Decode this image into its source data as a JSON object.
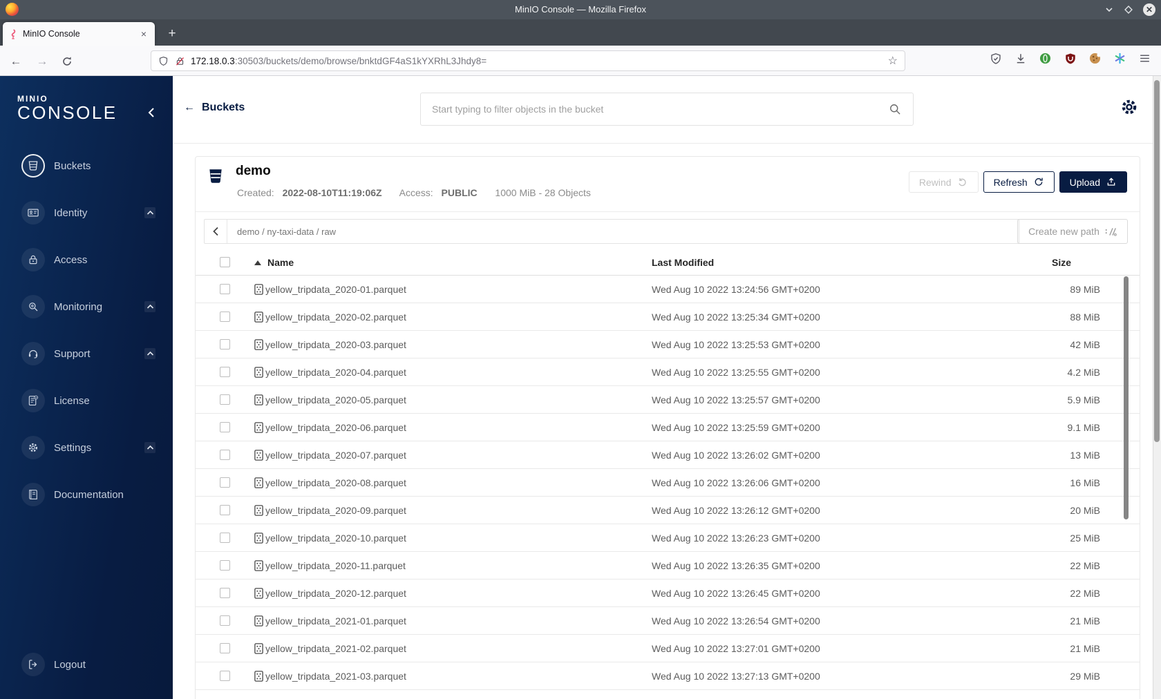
{
  "browser": {
    "window_title": "MinIO Console — Mozilla Firefox",
    "tab": {
      "title": "MinIO Console",
      "close_glyph": "×"
    },
    "new_tab_glyph": "+",
    "nav": {
      "back_glyph": "←",
      "forward_glyph": "→"
    },
    "url": {
      "host": "172.18.0.3",
      "rest": ":30503/buckets/demo/browse/bnktdGF4aS1kYXRhL3Jhdy8="
    },
    "star_glyph": "☆",
    "extension_icons": [
      "shield-check-icon",
      "download-icon",
      "green-extension-icon",
      "ublock-origin-icon",
      "cookie-icon",
      "container-asterisk-icon",
      "menu-icon"
    ]
  },
  "sidebar": {
    "logo_line1": "MINIO",
    "logo_line2": "CONSOLE",
    "items": [
      {
        "label": "Buckets",
        "icon": "bucket-icon",
        "active": true,
        "expandable": false
      },
      {
        "label": "Identity",
        "icon": "identity-icon",
        "active": false,
        "expandable": true
      },
      {
        "label": "Access",
        "icon": "lock-icon",
        "active": false,
        "expandable": false
      },
      {
        "label": "Monitoring",
        "icon": "monitoring-icon",
        "active": false,
        "expandable": true
      },
      {
        "label": "Support",
        "icon": "support-icon",
        "active": false,
        "expandable": true
      },
      {
        "label": "License",
        "icon": "license-icon",
        "active": false,
        "expandable": false
      },
      {
        "label": "Settings",
        "icon": "settings-icon",
        "active": false,
        "expandable": true
      },
      {
        "label": "Documentation",
        "icon": "documentation-icon",
        "active": false,
        "expandable": false
      }
    ],
    "logout": {
      "label": "Logout",
      "icon": "logout-icon"
    }
  },
  "header": {
    "back_glyph": "←",
    "back_label": "Buckets",
    "search_placeholder": "Start typing to filter objects in the bucket"
  },
  "bucket": {
    "name": "demo",
    "created_label": "Created:",
    "created_value": "2022-08-10T11:19:06Z",
    "access_label": "Access:",
    "access_value": "PUBLIC",
    "usage": "1000 MiB - 28 Objects",
    "actions": {
      "rewind": "Rewind",
      "refresh": "Refresh",
      "upload": "Upload"
    }
  },
  "browse": {
    "path": "demo / ny-taxi-data / raw",
    "create_path_label": "Create new path"
  },
  "table": {
    "columns": {
      "name": "Name",
      "modified": "Last Modified",
      "size": "Size"
    },
    "sort": "ascending",
    "rows": [
      {
        "name": "yellow_tripdata_2020-01.parquet",
        "modified": "Wed Aug 10 2022 13:24:56 GMT+0200",
        "size": "89 MiB"
      },
      {
        "name": "yellow_tripdata_2020-02.parquet",
        "modified": "Wed Aug 10 2022 13:25:34 GMT+0200",
        "size": "88 MiB"
      },
      {
        "name": "yellow_tripdata_2020-03.parquet",
        "modified": "Wed Aug 10 2022 13:25:53 GMT+0200",
        "size": "42 MiB"
      },
      {
        "name": "yellow_tripdata_2020-04.parquet",
        "modified": "Wed Aug 10 2022 13:25:55 GMT+0200",
        "size": "4.2 MiB"
      },
      {
        "name": "yellow_tripdata_2020-05.parquet",
        "modified": "Wed Aug 10 2022 13:25:57 GMT+0200",
        "size": "5.9 MiB"
      },
      {
        "name": "yellow_tripdata_2020-06.parquet",
        "modified": "Wed Aug 10 2022 13:25:59 GMT+0200",
        "size": "9.1 MiB"
      },
      {
        "name": "yellow_tripdata_2020-07.parquet",
        "modified": "Wed Aug 10 2022 13:26:02 GMT+0200",
        "size": "13 MiB"
      },
      {
        "name": "yellow_tripdata_2020-08.parquet",
        "modified": "Wed Aug 10 2022 13:26:06 GMT+0200",
        "size": "16 MiB"
      },
      {
        "name": "yellow_tripdata_2020-09.parquet",
        "modified": "Wed Aug 10 2022 13:26:12 GMT+0200",
        "size": "20 MiB"
      },
      {
        "name": "yellow_tripdata_2020-10.parquet",
        "modified": "Wed Aug 10 2022 13:26:23 GMT+0200",
        "size": "25 MiB"
      },
      {
        "name": "yellow_tripdata_2020-11.parquet",
        "modified": "Wed Aug 10 2022 13:26:35 GMT+0200",
        "size": "22 MiB"
      },
      {
        "name": "yellow_tripdata_2020-12.parquet",
        "modified": "Wed Aug 10 2022 13:26:45 GMT+0200",
        "size": "22 MiB"
      },
      {
        "name": "yellow_tripdata_2021-01.parquet",
        "modified": "Wed Aug 10 2022 13:26:54 GMT+0200",
        "size": "21 MiB"
      },
      {
        "name": "yellow_tripdata_2021-02.parquet",
        "modified": "Wed Aug 10 2022 13:27:01 GMT+0200",
        "size": "21 MiB"
      },
      {
        "name": "yellow_tripdata_2021-03.parquet",
        "modified": "Wed Aug 10 2022 13:27:13 GMT+0200",
        "size": "29 MiB"
      }
    ]
  },
  "colors": {
    "accent": "#081C42"
  }
}
